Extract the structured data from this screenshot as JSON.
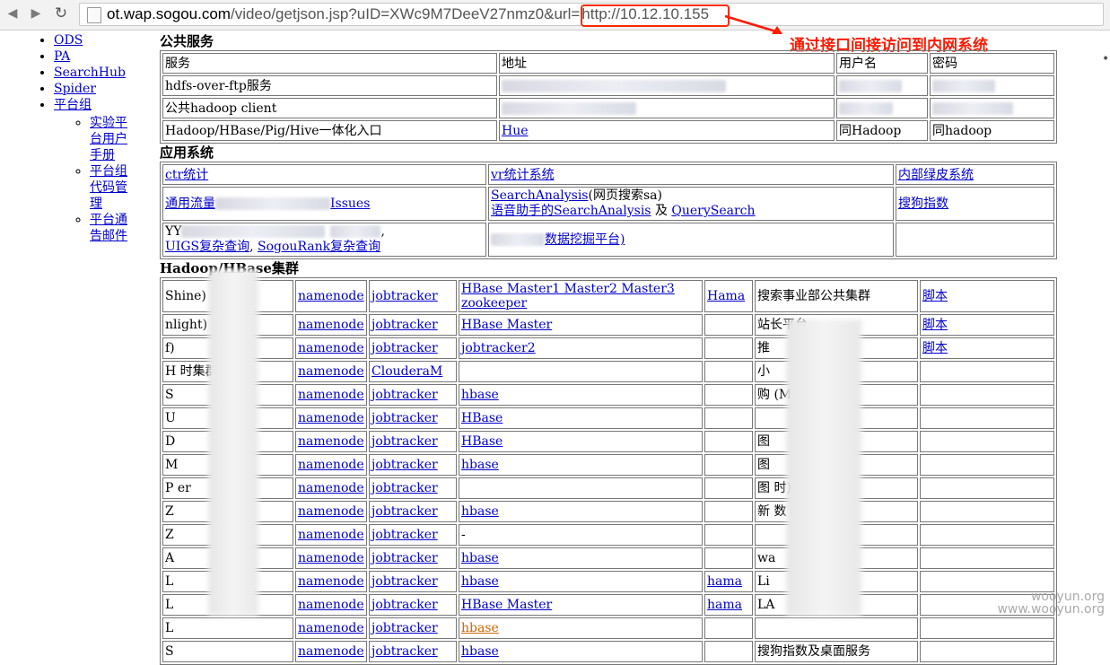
{
  "browser": {
    "url_host": "ot.wap.sogou.com",
    "url_path": "/video/getjson.jsp?uID=XWc9M7DeeV27nmz0&url=",
    "url_param": "http://10.12.10.155",
    "annotation": "通过接口间接访问到内网系统",
    "icons": [
      "back-icon",
      "forward-icon",
      "reload-icon",
      "page-icon"
    ]
  },
  "nav": {
    "items": [
      "ODS",
      "PA",
      "SearchHub",
      "Spider",
      "平台组"
    ],
    "sub_items": [
      "实验平台用户手册",
      "平台组代码管理",
      "平台通告邮件"
    ]
  },
  "public_services": {
    "heading": "公共服务",
    "headers": [
      "服务",
      "地址",
      "用户名",
      "密码"
    ],
    "rows": [
      [
        "hdfs-over-ftp服务",
        "",
        "",
        ""
      ],
      [
        "公共hadoop client",
        "",
        "",
        ""
      ],
      [
        "Hadoop/HBase/Pig/Hive一体化入口",
        "Hue",
        "同Hadoop",
        "同hadoop"
      ]
    ]
  },
  "app_systems": {
    "heading": "应用系统",
    "r1": [
      "ctr统计",
      "vr统计系统",
      "内部绿皮系统"
    ],
    "r2": {
      "c1_prefix": "通用流量",
      "c1_link": "Issues",
      "c2_link1": "SearchAnalysis",
      "c2_text1": "(网页搜索sa)",
      "c2_link2": "语音助手的SearchAnalysis",
      "c2_and": "及",
      "c2_link3": "QuerySearch",
      "c3": "搜狗指数"
    },
    "r3": {
      "c1_prefix": "YY",
      "c1_link1": "UIGS复杂查询",
      "c1_sep": ",",
      "c1_link2": "SogouRank复杂查询",
      "c2": "数据挖掘平台)"
    }
  },
  "hadoop": {
    "heading": "Hadoop/HBase集群",
    "rows": [
      {
        "c1": "Shine)",
        "nn": "namenode",
        "jt": "jobtracker",
        "hb": "HBase Master1 Master2 Master3 zookeeper",
        "hama": "Hama",
        "desc": "搜索事业部公共集群",
        "script": "脚本"
      },
      {
        "c1": "nlight)",
        "nn": "namenode",
        "jt": "jobtracker",
        "hb": "HBase Master",
        "hama": "",
        "desc": "站长平台",
        "script": "脚本"
      },
      {
        "c1": "f)",
        "nn": "namenode",
        "jt": "jobtracker",
        "hb": "jobtracker2",
        "hama": "",
        "desc": "推",
        "script": "脚本"
      },
      {
        "c1": "H 时集群",
        "nn": "namenode",
        "jt": "ClouderaM",
        "hb": "",
        "hama": "",
        "desc": "小",
        "script": ""
      },
      {
        "c1": "S",
        "nn": "namenode",
        "jt": "jobtracker",
        "hb": "hbase",
        "hama": "",
        "desc": "购 (Magic)",
        "script": ""
      },
      {
        "c1": "U",
        "nn": "namenode",
        "jt": "jobtracker",
        "hb": "HBase",
        "hama": "",
        "desc": "",
        "script": ""
      },
      {
        "c1": "D",
        "nn": "namenode",
        "jt": "jobtracker",
        "hb": "HBase",
        "hama": "",
        "desc": "图",
        "script": ""
      },
      {
        "c1": "M",
        "nn": "namenode",
        "jt": "jobtracker",
        "hb": "hbase",
        "hama": "",
        "desc": "图",
        "script": ""
      },
      {
        "c1": "P er",
        "nn": "namenode",
        "jt": "jobtracker",
        "hb": "",
        "hama": "",
        "desc": "图 时)",
        "script": ""
      },
      {
        "c1": "Z",
        "nn": "namenode",
        "jt": "jobtracker",
        "hb": "hbase",
        "hama": "",
        "desc": "新 数",
        "script": ""
      },
      {
        "c1": "Z",
        "nn": "namenode",
        "jt": "jobtracker",
        "hb": "-",
        "hama": "",
        "desc": "",
        "script": ""
      },
      {
        "c1": "A",
        "nn": "namenode",
        "jt": "jobtracker",
        "hb": "hbase",
        "hama": "",
        "desc": "wa",
        "script": ""
      },
      {
        "c1": "L",
        "nn": "namenode",
        "jt": "jobtracker",
        "hb": "hbase",
        "hama": "hama",
        "desc": "Li",
        "script": ""
      },
      {
        "c1": "L",
        "nn": "namenode",
        "jt": "jobtracker",
        "hb": "HBase Master",
        "hama": "hama",
        "desc": "LA",
        "script": ""
      },
      {
        "c1": "L",
        "nn": "namenode",
        "jt": "jobtracker",
        "hb": "hbase",
        "hama": "",
        "desc": "",
        "script": ""
      },
      {
        "c1": "S",
        "nn": "namenode",
        "jt": "jobtracker",
        "hb": "hbase",
        "hama": "",
        "desc": "搜狗指数及桌面服务",
        "script": ""
      }
    ]
  },
  "watermark": {
    "line1": "wooyun.org",
    "line2": "www.wooyun.org"
  }
}
